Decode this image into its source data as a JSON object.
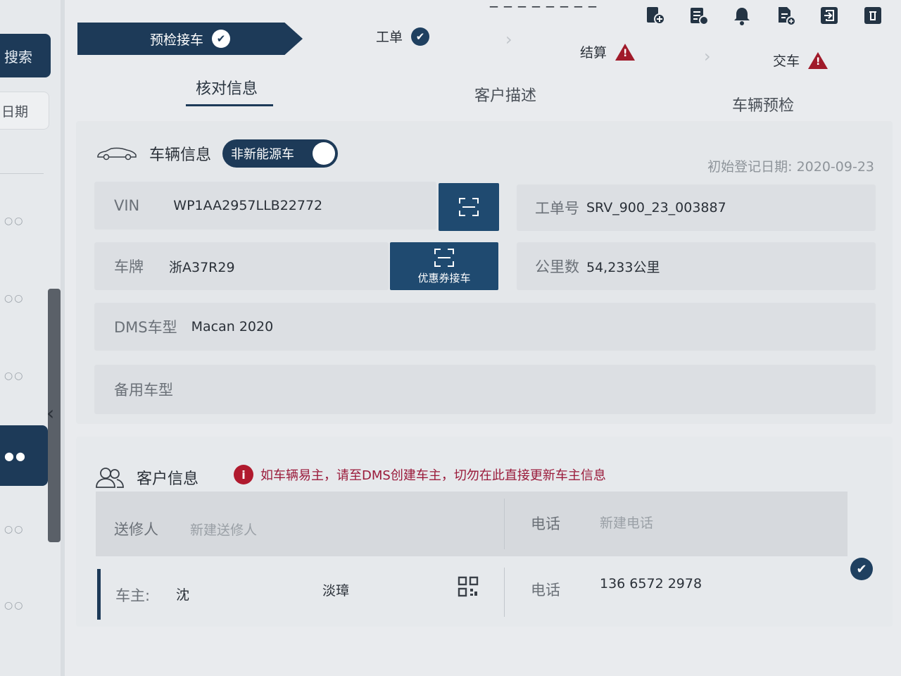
{
  "top": {
    "number_fragment": "_ _ _ _ _ _ _ _"
  },
  "left_rail": {
    "search_label": "搜索",
    "date_label": "日期",
    "dots": "○○",
    "active_dots": "●●"
  },
  "icons": [
    "add-user-icon",
    "list-icon",
    "bell-icon",
    "file-add-icon",
    "logout-icon",
    "trash-icon"
  ],
  "steps": [
    {
      "label": "预检接车",
      "status": "done"
    },
    {
      "label": "工单",
      "status": "done"
    },
    {
      "label": "结算",
      "status": "warning"
    },
    {
      "label": "交车",
      "status": "warning"
    }
  ],
  "subtabs": [
    {
      "label": "核对信息",
      "active": true
    },
    {
      "label": "客户描述",
      "active": false
    },
    {
      "label": "车辆预检",
      "active": false
    }
  ],
  "vehicle": {
    "title": "车辆信息",
    "energy_toggle": "非新能源车",
    "register_date_label": "初始登记日期:",
    "register_date": "2020-09-23",
    "vin_label": "VIN",
    "vin": "WP1AA2957LLB22772",
    "plate_label": "车牌",
    "plate": "浙A37R29",
    "coupon_button": "优惠券接车",
    "order_label": "工单号",
    "order_no": "SRV_900_23_003887",
    "mileage_label": "公里数",
    "mileage": "54,233公里",
    "dms_label": "DMS车型",
    "dms_model": "Macan 2020",
    "backup_label": "备用车型"
  },
  "customer": {
    "title": "客户信息",
    "notice": "如车辆易主，请至DMS创建车主，切勿在此直接更新车主信息",
    "sender_label": "送修人",
    "sender_placeholder": "新建送修人",
    "phone_label": "电话",
    "phone_placeholder": "新建电话",
    "owner_label": "车主:",
    "owner_surname": "沈",
    "owner_given": "淡璋",
    "owner_phone_label": "电话",
    "owner_phone": "136 6572 2978"
  },
  "colors": {
    "navy": "#1d3a58",
    "warning": "#a01a2a",
    "notice": "#9a1a3a"
  }
}
